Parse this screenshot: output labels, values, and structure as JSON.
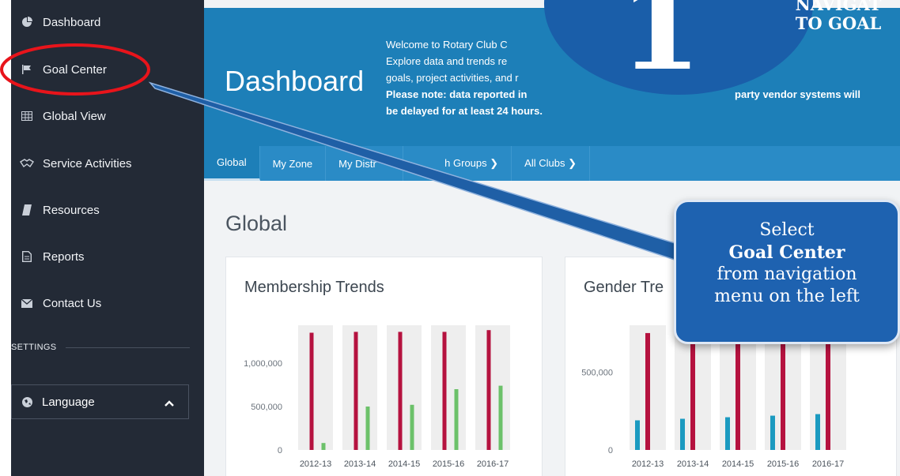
{
  "sidebar": {
    "items": [
      {
        "label": "Dashboard",
        "icon": "pie-chart-icon"
      },
      {
        "label": "Goal Center",
        "icon": "flag-icon"
      },
      {
        "label": "Global View",
        "icon": "grid-icon"
      },
      {
        "label": "Service Activities",
        "icon": "handshake-icon"
      },
      {
        "label": "Resources",
        "icon": "book-icon"
      },
      {
        "label": "Reports",
        "icon": "document-icon"
      },
      {
        "label": "Contact Us",
        "icon": "envelope-icon"
      }
    ],
    "settings_label": "SETTINGS",
    "language_label": "Language"
  },
  "header": {
    "title": "Dashboard",
    "welcome_line1": "Welcome to Rotary Club C",
    "welcome_line2": "Explore data and trends re",
    "welcome_line2_tail": "",
    "welcome_line3": "goals, project activities, and r",
    "welcome_line4_bold": "Please note: data reported in",
    "welcome_line4_tail": "party vendor systems will",
    "welcome_line5_bold": "be delayed for at least 24 hours."
  },
  "tabs": [
    {
      "label": "Global",
      "active": true
    },
    {
      "label": "My Zone"
    },
    {
      "label": "My Distr"
    },
    {
      "label": "h Groups ❯"
    },
    {
      "label": "All Clubs ❯"
    }
  ],
  "main": {
    "section_title": "Global"
  },
  "cards": [
    {
      "title": "Membership Trends"
    },
    {
      "title": "Gender Tre"
    }
  ],
  "chart_data": [
    {
      "type": "bar",
      "title": "Membership Trends",
      "categories": [
        "2012-13",
        "2013-14",
        "2014-15",
        "2015-16",
        "2016-17"
      ],
      "yticks": [
        "1,000,000",
        "500,000",
        "0"
      ],
      "ylim": [
        0,
        1400000
      ],
      "series": [
        {
          "values": [
            1350000,
            1360000,
            1360000,
            1360000,
            1380000
          ],
          "color": "#b5123f"
        },
        {
          "values": [
            80000,
            500000,
            520000,
            700000,
            740000
          ],
          "color": "#6cc16a"
        }
      ]
    },
    {
      "type": "bar",
      "title": "Gender Tre",
      "categories": [
        "2012-13",
        "2013-14",
        "2014-15",
        "2015-16",
        "2016-17"
      ],
      "yticks": [
        "500,000",
        "0"
      ],
      "ylim": [
        0,
        780000
      ],
      "series": [
        {
          "values": [
            190000,
            200000,
            210000,
            220000,
            230000
          ],
          "color": "#1b9ac0"
        },
        {
          "values": [
            750000,
            750000,
            750000,
            750000,
            750000
          ],
          "color": "#b5123f"
        }
      ]
    }
  ],
  "callout": {
    "line1": "Select",
    "line2": "Goal Center",
    "line3": "from navigation",
    "line4": "menu on the left"
  },
  "step": {
    "number": "1",
    "line1": "NAVIGAT",
    "line2": "TO GOAL"
  },
  "colors": {
    "sidebar_bg": "#232a36",
    "hero_bg": "#1d7fb8",
    "highlight_red": "#e8141b",
    "callout_bg": "#1e62b0"
  }
}
